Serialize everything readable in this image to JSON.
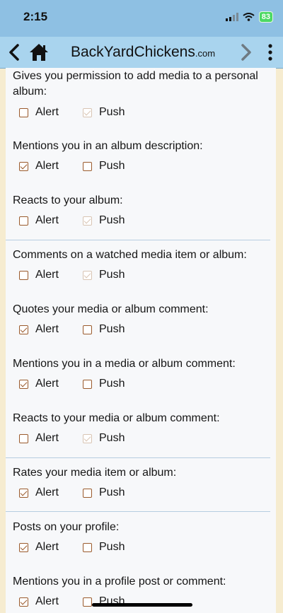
{
  "status": {
    "time": "2:15",
    "battery": "83"
  },
  "nav": {
    "title": "BackYardChickens",
    "title_tld": ".com"
  },
  "options": {
    "alert_label": "Alert",
    "push_label": "Push"
  },
  "sections": [
    {
      "label_line1": "Gives you permission to add media to a personal",
      "label_line2": "album:",
      "alert": false,
      "push": true,
      "push_disabled": true
    },
    {
      "label_line1": "Mentions you in an album description:",
      "alert": true,
      "push": false,
      "push_disabled": false
    },
    {
      "label_line1": "Reacts to your album:",
      "alert": false,
      "push": true,
      "push_disabled": true
    },
    {
      "label_line1": "Comments on a watched media item or album:",
      "alert": false,
      "push": true,
      "push_disabled": true
    },
    {
      "label_line1": "Quotes your media or album comment:",
      "alert": true,
      "push": false,
      "push_disabled": false
    },
    {
      "label_line1": "Mentions you in a media or album comment:",
      "alert": true,
      "push": false,
      "push_disabled": false
    },
    {
      "label_line1": "Reacts to your media or album comment:",
      "alert": false,
      "push": true,
      "push_disabled": true
    },
    {
      "label_line1": "Rates your media item or album:",
      "alert": true,
      "push": false,
      "push_disabled": false
    },
    {
      "label_line1": "Posts on your profile:",
      "alert": true,
      "push": false,
      "push_disabled": false
    },
    {
      "label_line1": "Mentions you in a profile post or comment:",
      "alert": true,
      "push": false,
      "push_disabled": false
    }
  ]
}
